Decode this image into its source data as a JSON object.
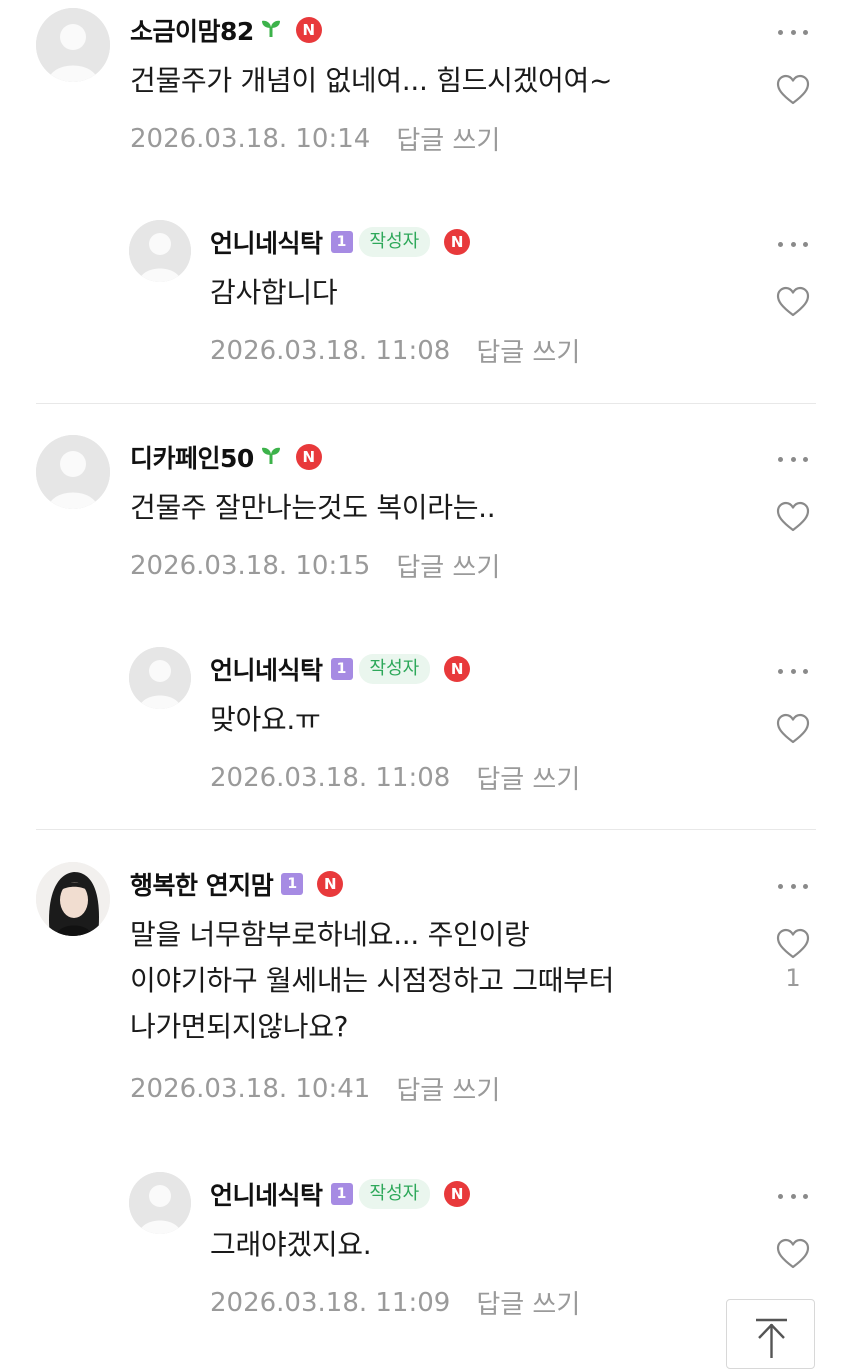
{
  "comments": [
    {
      "author": "소금이맘82",
      "badge_type": "sprout-icon",
      "content_lines": [
        "건물주가 개념이 없네여... 힘드시겠어여~"
      ],
      "date": "2026.03.18. 10:14",
      "reply_label": "답글 쓰기",
      "likes": ""
    },
    {
      "author": "언니네식탁",
      "level": "1",
      "author_tag": "작성자",
      "content_lines": [
        "감사합니다"
      ],
      "date": "2026.03.18. 11:08",
      "reply_label": "답글 쓰기",
      "likes": ""
    },
    {
      "author": "디카페인50",
      "badge_type": "sprout-icon",
      "content_lines": [
        "건물주 잘만나는것도 복이라는.."
      ],
      "date": "2026.03.18. 10:15",
      "reply_label": "답글 쓰기",
      "likes": ""
    },
    {
      "author": "언니네식탁",
      "level": "1",
      "author_tag": "작성자",
      "content_lines": [
        "맞아요.ㅠ"
      ],
      "date": "2026.03.18. 11:08",
      "reply_label": "답글 쓰기",
      "likes": ""
    },
    {
      "author": "행복한 연지맘",
      "level": "1",
      "content_lines": [
        "말을 너무함부로하네요... 주인이랑",
        "이야기하구 월세내는 시점정하고 그때부터",
        "나가면되지않나요?"
      ],
      "date": "2026.03.18. 10:41",
      "reply_label": "답글 쓰기",
      "likes": "1"
    },
    {
      "author": "언니네식탁",
      "level": "1",
      "author_tag": "작성자",
      "content_lines": [
        "그래야겠지요."
      ],
      "date": "2026.03.18. 11:09",
      "reply_label": "답글 쓰기",
      "likes": ""
    }
  ],
  "n_badge": "N",
  "icons": {
    "more": "more-dots-icon",
    "like": "heart-outline-icon",
    "scroll_top": "arrow-up-icon",
    "avatar_default": "default-avatar-icon"
  },
  "colors": {
    "n_badge": "#e8393b",
    "author_tag_text": "#2ea85a",
    "author_tag_bg": "#eaf6ee",
    "level_badge": "#a68be3",
    "sprout": "#3cb24a",
    "meta_text": "#9a9a9a"
  }
}
